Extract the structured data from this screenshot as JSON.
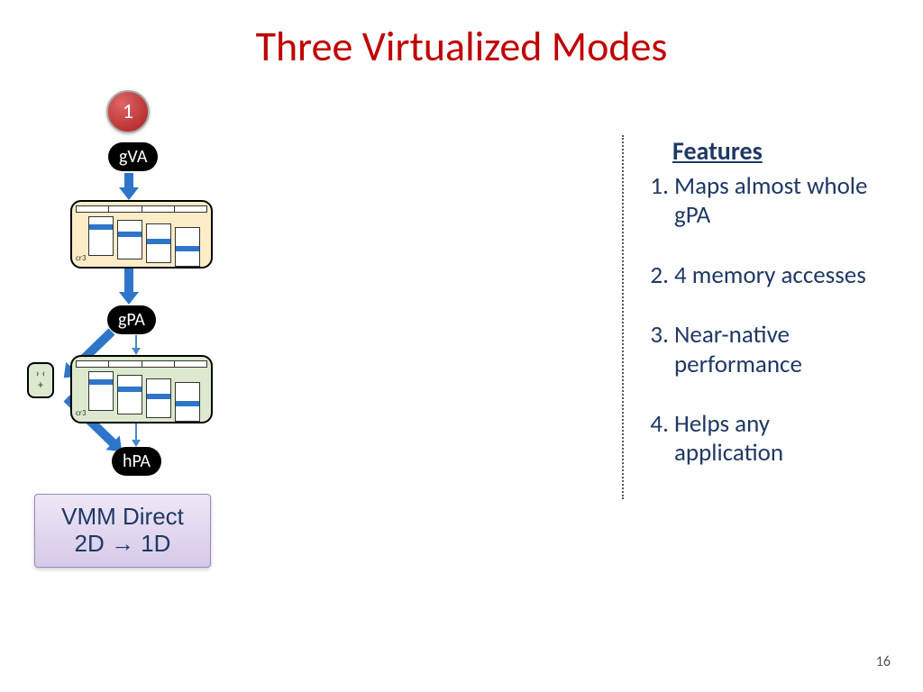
{
  "title": "Three Virtualized Modes",
  "mode_number": "1",
  "nodes": {
    "gva": "gVA",
    "gpa": "gPA",
    "hpa": "hPA"
  },
  "ptable": {
    "cr3_label": "cr3",
    "mult_glyph": "› ‹\n+"
  },
  "mode_label": {
    "line1": "VMM Direct",
    "line2": "2D → 1D"
  },
  "features": {
    "heading": "Features",
    "items": [
      "Maps almost whole gPA",
      "4 memory accesses",
      "Near-native performance",
      "Helps any application"
    ]
  },
  "page_number": "16"
}
